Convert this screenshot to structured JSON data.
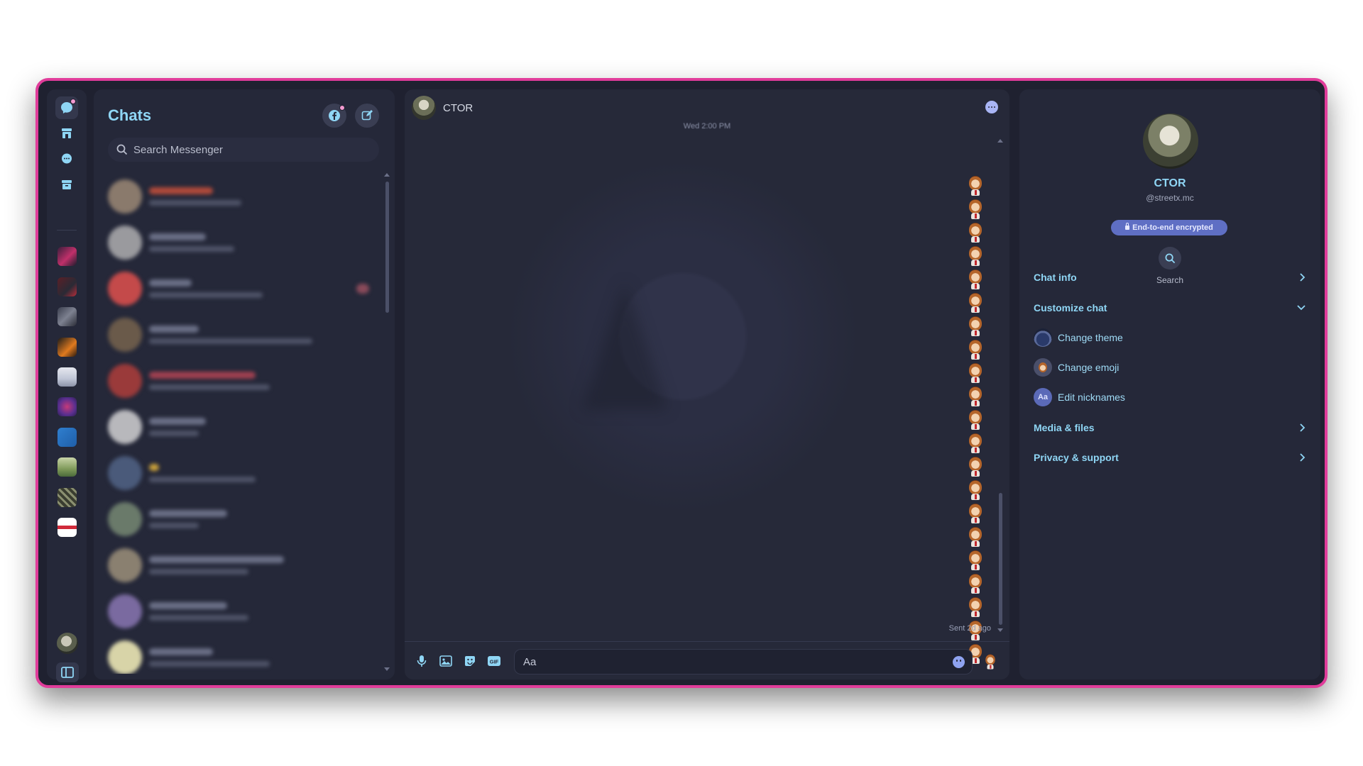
{
  "chats": {
    "title": "Chats",
    "search_placeholder": "Search Messenger"
  },
  "conversation": {
    "contact_name": "CTOR",
    "date_separator": "Wed 2:00 PM",
    "sent_label": "Sent 2d ago",
    "composer_placeholder": "Aa"
  },
  "info_panel": {
    "name": "CTOR",
    "handle": "@streetx.mc",
    "encryption_badge": "End-to-end encrypted",
    "search_label": "Search",
    "sections": {
      "chat_info": "Chat info",
      "customize_chat": "Customize chat",
      "change_theme": "Change theme",
      "change_emoji": "Change emoji",
      "edit_nicknames": "Edit nicknames",
      "nickname_icon": "Aa",
      "media_files": "Media & files",
      "privacy_support": "Privacy & support"
    }
  },
  "colors": {
    "accent": "#8fd6f5",
    "window_border": "#e03c9a",
    "badge": "#5f6fc4"
  }
}
